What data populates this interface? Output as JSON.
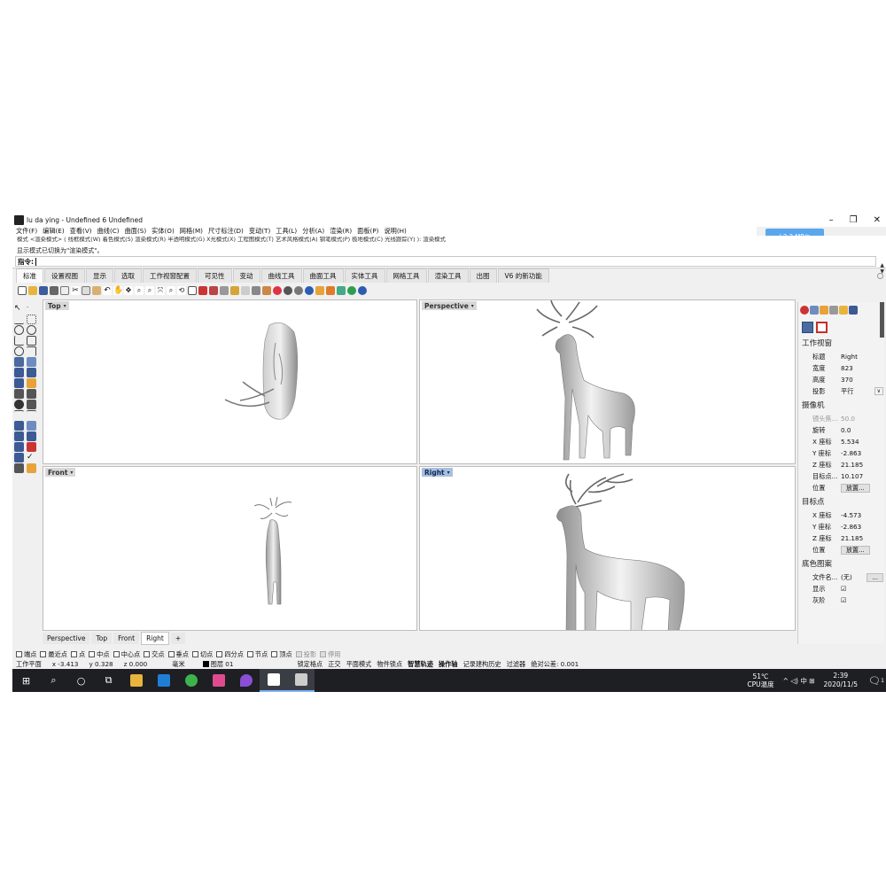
{
  "window": {
    "title": "lu da ying - Undefined 6 Undefined",
    "controls": [
      "–",
      "❐",
      "✕"
    ]
  },
  "cloud_badge": "↓2.3 MB/s",
  "menus": [
    "文件(F)",
    "编辑(E)",
    "查看(V)",
    "曲线(C)",
    "曲面(S)",
    "实体(O)",
    "网格(M)",
    "尺寸标注(D)",
    "变动(T)",
    "工具(L)",
    "分析(A)",
    "渲染(R)",
    "面板(P)",
    "说明(H)"
  ],
  "command": {
    "history_line": "模式 <渲染模式> ( 线框模式(W) 着色模式(S) 渲染模式(R) 半透明模式(G) X光模式(X) 工程图模式(T) 艺术风格模式(A) 钢笔模式(P) 极地模式(C) 光线跟踪(Y) ): 渲染模式",
    "message": "显示模式已切换为\"渲染模式\"。",
    "prompt": "指令:"
  },
  "ribbon_tabs": [
    "标准",
    "设置视图",
    "显示",
    "选取",
    "工作视窗配置",
    "可见性",
    "变动",
    "曲线工具",
    "曲面工具",
    "实体工具",
    "网格工具",
    "渲染工具",
    "出图",
    "V6 的新功能"
  ],
  "active_ribbon_tab": "标准",
  "viewports": {
    "top": "Top",
    "perspective": "Perspective",
    "front": "Front",
    "right": "Right"
  },
  "viewport_tabs": [
    "Perspective",
    "Top",
    "Front",
    "Right",
    "+"
  ],
  "active_viewport_tab": "Right",
  "properties": {
    "section_view": "工作视窗",
    "rows_view": [
      {
        "k": "标题",
        "v": "Right"
      },
      {
        "k": "宽度",
        "v": "823"
      },
      {
        "k": "高度",
        "v": "370"
      },
      {
        "k": "投影",
        "v": "平行"
      }
    ],
    "section_camera": "摄像机",
    "rows_camera": [
      {
        "k": "镜头焦...",
        "v": "50.0"
      },
      {
        "k": "旋转",
        "v": "0.0"
      },
      {
        "k": "X 座标",
        "v": "5.534"
      },
      {
        "k": "Y 座标",
        "v": "-2.863"
      },
      {
        "k": "Z 座标",
        "v": "21.185"
      },
      {
        "k": "目标点...",
        "v": "10.107"
      },
      {
        "k": "位置",
        "v": "放置..."
      }
    ],
    "section_target": "目标点",
    "rows_target": [
      {
        "k": "X 座标",
        "v": "-4.573"
      },
      {
        "k": "Y 座标",
        "v": "-2.863"
      },
      {
        "k": "Z 座标",
        "v": "21.185"
      },
      {
        "k": "位置",
        "v": "放置..."
      }
    ],
    "section_bg": "底色图案",
    "rows_bg": [
      {
        "k": "文件名...",
        "v": "(无)"
      },
      {
        "k": "显示",
        "v": "☑"
      },
      {
        "k": "灰阶",
        "v": "☑"
      }
    ]
  },
  "snaps": [
    "端点",
    "最近点",
    "点",
    "中点",
    "中心点",
    "交点",
    "垂点",
    "切点",
    "四分点",
    "节点",
    "顶点"
  ],
  "snaps_disabled": [
    "投影",
    "停用"
  ],
  "status": {
    "cplane": "工作平面",
    "x": "x -3.413",
    "y": "y 0.328",
    "z": "z 0.000",
    "unit": "毫米",
    "layer": "图层 01",
    "items": [
      "锁定格点",
      "正交",
      "平面模式",
      "物件锁点"
    ],
    "bold_items": [
      "智慧轨迹",
      "操作轴"
    ],
    "tail_items": [
      "记录建构历史",
      "过滤器",
      "绝对公差: 0.001"
    ]
  },
  "taskbar": {
    "temp": "51℃",
    "temp_label": "CPU温度",
    "tray_icons": "^ ◁) 中 ⊞",
    "time": "2:39",
    "date": "2020/11/5",
    "notify": "1"
  },
  "colors": {
    "accent_active_viewport": "#a8c0de",
    "taskbar": "#1d1f23",
    "cloud_badge": "#5aa7ee"
  }
}
